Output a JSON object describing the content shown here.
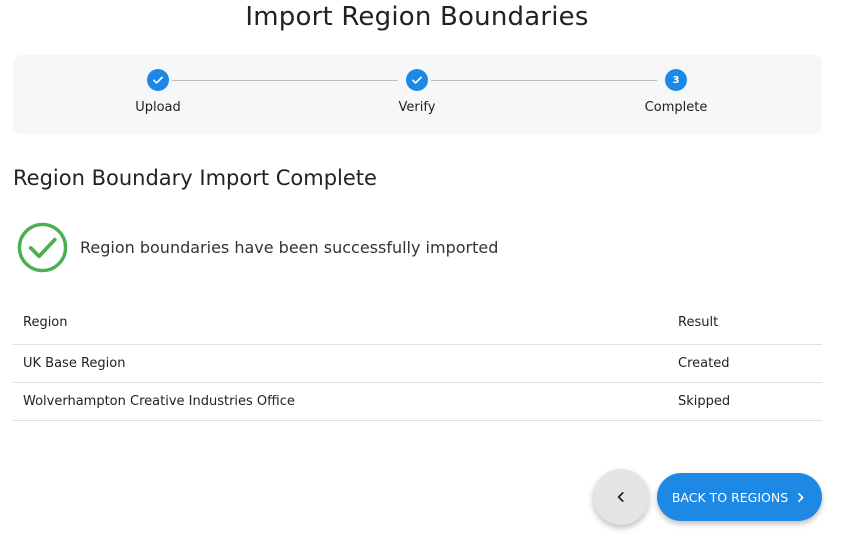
{
  "header": {
    "title": "Import Region Boundaries"
  },
  "stepper": {
    "steps": [
      {
        "label": "Upload",
        "state": "done",
        "icon": "check-icon"
      },
      {
        "label": "Verify",
        "state": "done",
        "icon": "check-icon"
      },
      {
        "label": "Complete",
        "state": "active",
        "number": "3"
      }
    ]
  },
  "main": {
    "heading": "Region Boundary Import Complete",
    "success_message": "Region boundaries have been successfully imported",
    "success_icon": "check-circle-icon",
    "table": {
      "columns": [
        "Region",
        "Result"
      ],
      "rows": [
        [
          "UK Base Region",
          "Created"
        ],
        [
          "Wolverhampton Creative Industries Office",
          "Skipped"
        ]
      ]
    }
  },
  "actions": {
    "back_icon": "chevron-left-icon",
    "primary_label": "BACK TO REGIONS",
    "primary_icon": "chevron-right-icon"
  },
  "colors": {
    "accent": "#1e88e5",
    "success": "#4caf50",
    "stepper_bg": "#f6f7f9"
  }
}
